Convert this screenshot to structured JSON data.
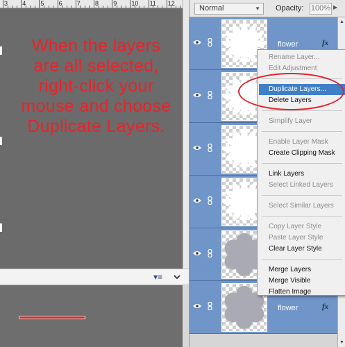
{
  "ruler": {
    "numbers": [
      "3",
      "4",
      "5",
      "6",
      "7",
      "8",
      "9",
      "10",
      "11",
      "12"
    ]
  },
  "canvas": {
    "instruction_lines": [
      "When the layers",
      "are all selected,",
      "right-click your",
      "mouse and choose",
      "Duplicate Layers."
    ],
    "instruction_color": "#e8232a"
  },
  "panel_bar": {
    "menu_icon": "panel-menu-icon",
    "chevron_icon": "chevron-down-icon"
  },
  "progress": {
    "percent": 100,
    "fill_color": "#c42a2a"
  },
  "layers_panel": {
    "blend_mode": "Normal",
    "opacity_label": "Opacity:",
    "opacity_value": "100%",
    "selection_color": "#6f95c9",
    "layers": [
      {
        "name": "flower",
        "thumb": "white-flower",
        "fx": "fx"
      },
      {
        "name": "",
        "thumb": "white-flower",
        "fx": ""
      },
      {
        "name": "",
        "thumb": "white-flower",
        "fx": ""
      },
      {
        "name": "",
        "thumb": "white-flower",
        "fx": ""
      },
      {
        "name": "",
        "thumb": "gray-flower",
        "fx": ""
      },
      {
        "name": "flower",
        "thumb": "gray-flower",
        "fx": "fx"
      }
    ]
  },
  "context_menu": {
    "groups": [
      [
        {
          "label": "Rename Layer...",
          "enabled": false
        },
        {
          "label": "Edit Adjustment",
          "enabled": false
        }
      ],
      [
        {
          "label": "Duplicate Layers...",
          "enabled": true,
          "highlighted": true
        },
        {
          "label": "Delete Layers",
          "enabled": true
        }
      ],
      [
        {
          "label": "Simplify Layer",
          "enabled": false
        }
      ],
      [
        {
          "label": "Enable Layer Mask",
          "enabled": false
        },
        {
          "label": "Create Clipping Mask",
          "enabled": true
        }
      ],
      [
        {
          "label": "Link Layers",
          "enabled": true
        },
        {
          "label": "Select Linked Layers",
          "enabled": false
        }
      ],
      [
        {
          "label": "Select Similar Layers",
          "enabled": false
        }
      ],
      [
        {
          "label": "Copy Layer Style",
          "enabled": false
        },
        {
          "label": "Paste Layer Style",
          "enabled": false
        },
        {
          "label": "Clear Layer Style",
          "enabled": true
        }
      ],
      [
        {
          "label": "Merge Layers",
          "enabled": true
        },
        {
          "label": "Merge Visible",
          "enabled": true
        },
        {
          "label": "Flatten Image",
          "enabled": true
        }
      ]
    ],
    "callout_color": "#e2232b"
  }
}
